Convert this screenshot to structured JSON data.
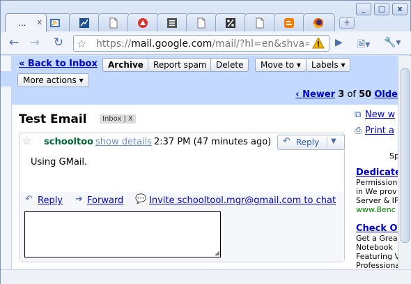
{
  "browser": {
    "tabs": [
      {
        "title": "...",
        "icon": "gmail-icon",
        "close": "x"
      },
      {
        "title": "",
        "icon": "rss-feed-icon"
      },
      {
        "title": "",
        "icon": "chart-icon"
      },
      {
        "title": "",
        "icon": "blank-page-icon"
      },
      {
        "title": "",
        "icon": "puzzle-icon"
      },
      {
        "title": "",
        "icon": "list-icon"
      },
      {
        "title": "",
        "icon": "blank-page-icon"
      },
      {
        "title": "",
        "icon": "coupon-icon"
      },
      {
        "title": "",
        "icon": "blank-page-icon"
      },
      {
        "title": "",
        "icon": "blogger-icon"
      },
      {
        "title": "",
        "icon": "firefox-icon"
      }
    ],
    "new_tab_label": "+",
    "url_prefix": "https://",
    "url_host": "mail.google.com",
    "url_path": "/mail/?hl=en&shva=",
    "window_controls": [
      "_",
      "□",
      "x"
    ]
  },
  "gmail": {
    "back_link": "« Back to Inbox",
    "buttons": {
      "archive": "Archive",
      "report_spam": "Report spam",
      "delete": "Delete",
      "move_to": "Move to ▾",
      "labels": "Labels ▾",
      "more_actions": "More actions ▾"
    },
    "pager": {
      "newer": "‹ Newer",
      "current": "3",
      "of": "of",
      "total": "50",
      "older": "Olde"
    },
    "subject": "Test Email",
    "label_chip": "Inbox | X",
    "message": {
      "sender": "schooltool",
      "show_details": "show details",
      "time": "2:37 PM (47 minutes ago)",
      "reply_label": "Reply",
      "body": "Using GMail.",
      "actions": {
        "reply": "Reply",
        "forward": "Forward",
        "invite": "Invite schooltool.mgr@gmail.com to chat"
      }
    },
    "sidebar": {
      "new_window": "New w",
      "print": "Print a",
      "sponsored": "Sp",
      "ads": [
        {
          "title": "Dedicate",
          "lines": [
            "Permission",
            "in We prov",
            "Server & IF"
          ],
          "url": "www.Benc"
        },
        {
          "title": "Check Ou",
          "lines": [
            "Get a Great",
            "Notebook",
            "Featuring V",
            "Professional"
          ],
          "url": ""
        }
      ]
    }
  }
}
